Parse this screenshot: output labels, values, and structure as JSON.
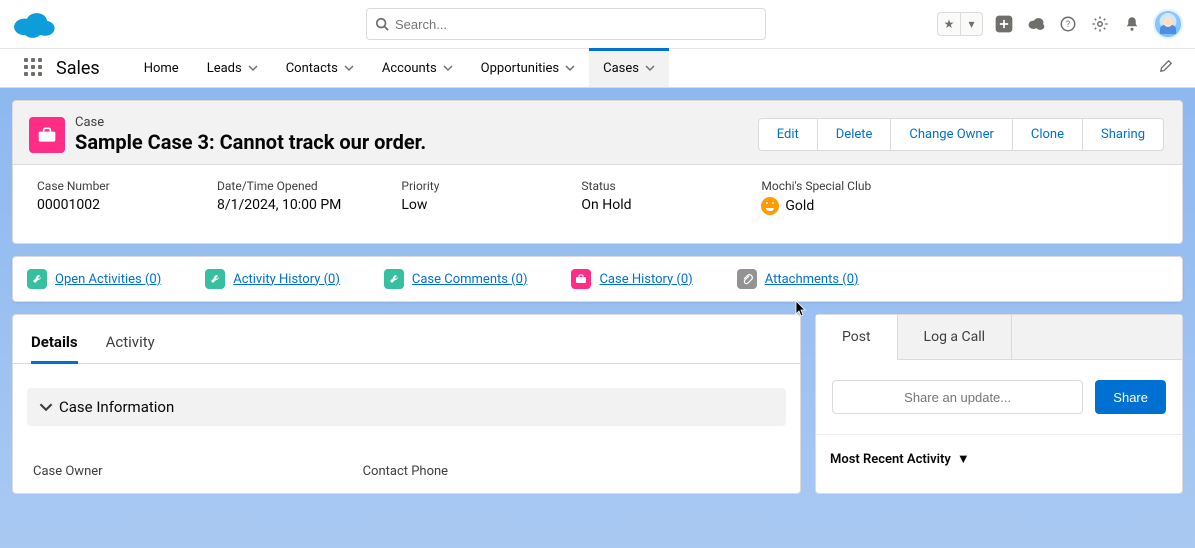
{
  "header": {
    "search_placeholder": "Search..."
  },
  "nav": {
    "app_name": "Sales",
    "items": [
      {
        "label": "Home",
        "has_menu": false
      },
      {
        "label": "Leads",
        "has_menu": true
      },
      {
        "label": "Contacts",
        "has_menu": true
      },
      {
        "label": "Accounts",
        "has_menu": true
      },
      {
        "label": "Opportunities",
        "has_menu": true
      },
      {
        "label": "Cases",
        "has_menu": true,
        "active": true
      }
    ]
  },
  "record": {
    "object_label": "Case",
    "title": "Sample Case 3: Cannot track our order.",
    "actions": {
      "edit": "Edit",
      "delete": "Delete",
      "change_owner": "Change Owner",
      "clone": "Clone",
      "sharing": "Sharing"
    },
    "fields": {
      "case_number": {
        "label": "Case Number",
        "value": "00001002"
      },
      "date_time_opened": {
        "label": "Date/Time Opened",
        "value": "8/1/2024, 10:00 PM"
      },
      "priority": {
        "label": "Priority",
        "value": "Low"
      },
      "status": {
        "label": "Status",
        "value": "On Hold"
      },
      "special_club": {
        "label": "Mochi's Special Club",
        "value": "Gold"
      }
    }
  },
  "related": {
    "open_activities": "Open Activities (0)",
    "activity_history": "Activity History (0)",
    "case_comments": "Case Comments (0)",
    "case_history": "Case History (0)",
    "attachments": "Attachments (0)"
  },
  "details": {
    "tabs": {
      "details": "Details",
      "activity": "Activity"
    },
    "section_title": "Case Information",
    "field_labels": {
      "case_owner": "Case Owner",
      "contact_phone": "Contact Phone"
    }
  },
  "feed": {
    "tabs": {
      "post": "Post",
      "log_a_call": "Log a Call"
    },
    "share_placeholder": "Share an update...",
    "share_button": "Share",
    "mra_label": "Most Recent Activity"
  }
}
